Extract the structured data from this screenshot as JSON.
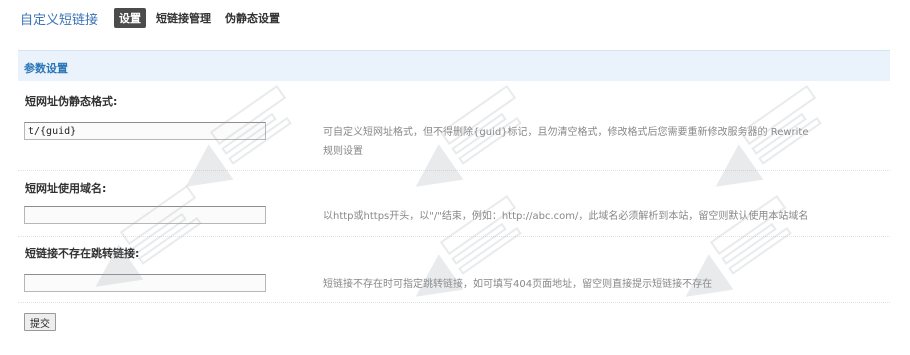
{
  "header": {
    "title": "自定义短链接",
    "tabs": [
      {
        "label": "设置",
        "active": true
      },
      {
        "label": "短链接管理",
        "active": false
      },
      {
        "label": "伪静态设置",
        "active": false
      }
    ]
  },
  "section": {
    "title": "参数设置"
  },
  "fields": [
    {
      "label": "短网址伪静态格式:",
      "value": "t/{guid}",
      "hint_line1": "可自定义短网址格式，但不得删除{guid}标记，且勿清空格式，修改格式后您需要重新修改服务器的 Rewrite",
      "hint_line2": "规则设置"
    },
    {
      "label": "短网址使用域名:",
      "value": "",
      "hint_line1": "以http或https开头，以\"/\"结束，例如：http://abc.com/，此域名必须解析到本站，留空则默认使用本站域名"
    },
    {
      "label": "短链接不存在跳转链接:",
      "value": "",
      "hint_line1": "短链接不存在时可指定跳转链接，如可填写404页面地址，留空则直接提示短链接不存在"
    }
  ],
  "actions": {
    "submit_label": "提交"
  },
  "colors": {
    "title": "#3a73b4",
    "active_tab_bg": "#4b4b4b",
    "section_bg": "#eaf3fb",
    "section_title": "#2a75b8",
    "hint": "#888888"
  }
}
